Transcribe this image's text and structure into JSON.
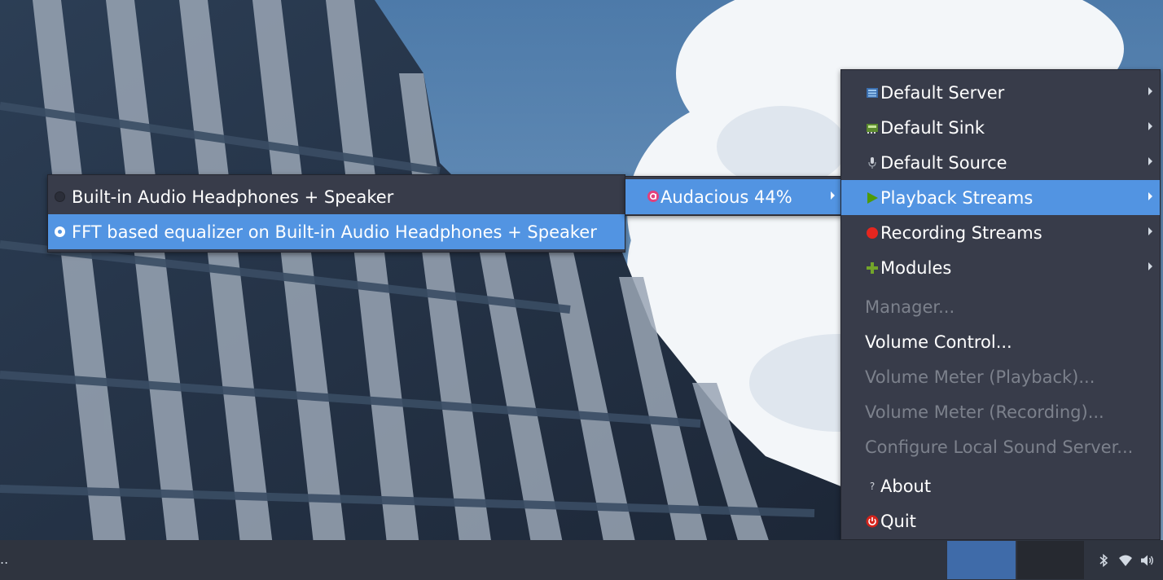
{
  "main_menu": {
    "items": [
      {
        "label": "Default Server",
        "icon": "server-icon",
        "submenu": true
      },
      {
        "label": "Default Sink",
        "icon": "sink-card-icon",
        "submenu": true
      },
      {
        "label": "Default Source",
        "icon": "microphone-icon",
        "submenu": true
      },
      {
        "label": "Playback Streams",
        "icon": "play-icon",
        "submenu": true,
        "highlighted": true
      },
      {
        "label": "Recording Streams",
        "icon": "record-icon",
        "submenu": true
      },
      {
        "label": "Modules",
        "icon": "plus-icon",
        "submenu": true
      },
      {
        "label": "Manager...",
        "disabled": true
      },
      {
        "label": "Volume Control..."
      },
      {
        "label": "Volume Meter (Playback)...",
        "disabled": true
      },
      {
        "label": "Volume Meter (Recording)...",
        "disabled": true
      },
      {
        "label": "Configure Local Sound Server...",
        "disabled": true
      },
      {
        "label": "About",
        "icon": "help-icon"
      },
      {
        "label": "Quit",
        "icon": "power-icon"
      }
    ]
  },
  "streams_menu": {
    "items": [
      {
        "label": "Audacious  44%",
        "icon": "audacious-icon",
        "submenu": true,
        "highlighted": true
      }
    ]
  },
  "sinks_menu": {
    "items": [
      {
        "label": "Built-in Audio Headphones + Speaker",
        "selected": false
      },
      {
        "label": "FFT based equalizer on Built-in Audio Headphones + Speaker",
        "selected": true,
        "highlighted": true
      }
    ]
  },
  "taskbar": {
    "left_text": "..",
    "tray_icons": [
      "bluetooth-icon",
      "wifi-icon",
      "volume-icon"
    ]
  },
  "colors": {
    "menu_bg": "#383c4a",
    "highlight": "#5294e2",
    "text": "#ffffff",
    "disabled_text": "#7c818c",
    "taskbar_bg": "#2f343f"
  }
}
